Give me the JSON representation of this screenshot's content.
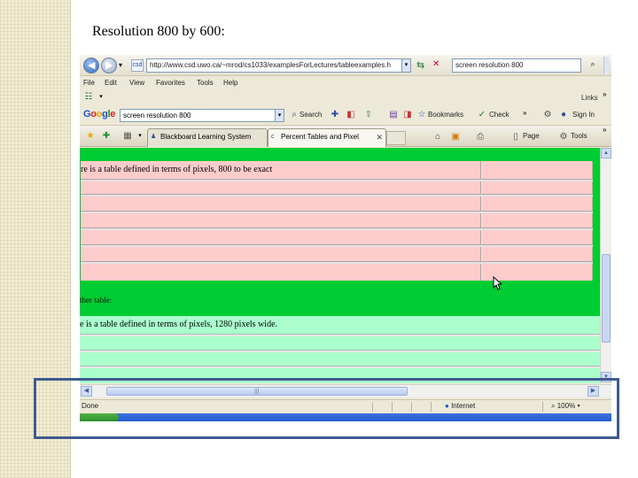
{
  "slide": {
    "title": "Resolution 800 by 600:"
  },
  "browser": {
    "address": {
      "url": "http://www.csd.uwo.ca/~mrod/cs1033/examplesForLectures/tableexamples.h"
    },
    "search": {
      "value": "screen resolution 800"
    },
    "menu": [
      "File",
      "Edit",
      "View",
      "Favorites",
      "Tools",
      "Help"
    ],
    "links_label": "Links",
    "google_toolbar": {
      "logo": "Google",
      "query": "screen resolution 800",
      "search_label": "Search",
      "bookmarks_label": "Bookmarks",
      "check_label": "Check",
      "signin_label": "Sign In"
    },
    "tabs": [
      {
        "label": "Blackboard Learning System"
      },
      {
        "label": "Percent Tables and Pixel"
      }
    ],
    "commands": {
      "page_label": "Page",
      "tools_label": "Tools"
    },
    "content": {
      "pink_table_text": "re is a table defined in terms of pixels, 800 to be exact",
      "other_label": "ther table:",
      "aqua_table_text": "e is a table defined in terms of pixels, 1280 pixels wide."
    },
    "status": {
      "text": "Done",
      "zone": "Internet",
      "zoom": "100%"
    }
  },
  "colors": {
    "page_background": "#00cc33",
    "pink_table": "#ffcccc",
    "aqua_table": "#aaffcc",
    "highlight_frame": "#3f5a8f"
  }
}
